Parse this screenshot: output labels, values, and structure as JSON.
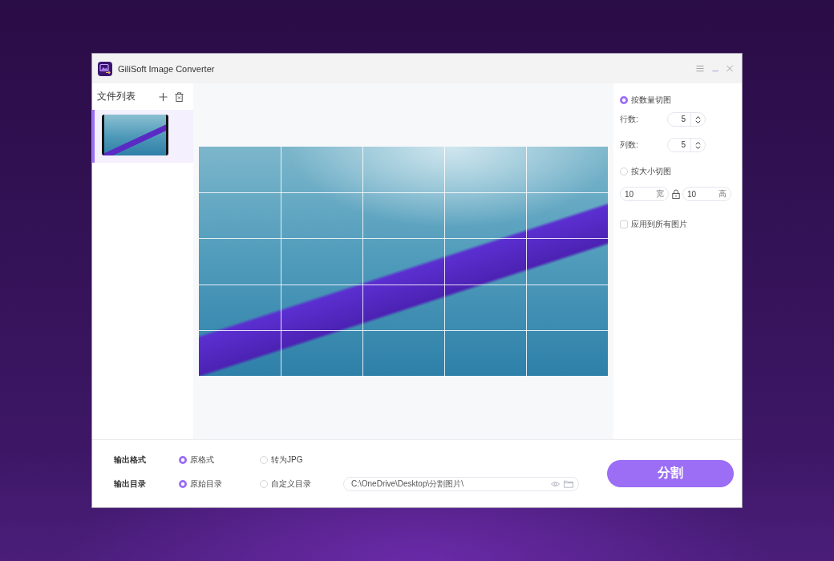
{
  "window": {
    "title": "GiliSoft Image Converter"
  },
  "file_list": {
    "title": "文件列表",
    "items": [
      {
        "selected": true
      }
    ]
  },
  "split_mode": [
    {
      "kind": "count",
      "label": "按数量切图",
      "selected": true,
      "fields": [
        {
          "label": "行数:",
          "value": "5"
        },
        {
          "label": "列数:",
          "value": "5"
        }
      ]
    },
    {
      "kind": "size",
      "label": "按大小切图",
      "selected": false,
      "fields": [
        {
          "value": "10",
          "unit": "宽"
        },
        {
          "value": "10",
          "unit": "高"
        }
      ]
    }
  ],
  "apply_all": {
    "label": "应用到所有图片",
    "checked": false
  },
  "output": [
    {
      "label": "输出格式",
      "options": [
        {
          "label": "原格式",
          "selected": true
        },
        {
          "label": "转为JPG",
          "selected": false
        }
      ]
    },
    {
      "label": "输出目录",
      "options": [
        {
          "label": "原始目录",
          "selected": true
        },
        {
          "label": "自定义目录",
          "selected": false
        }
      ],
      "path": "C:\\OneDrive\\Desktop\\分割图片\\"
    }
  ],
  "split_button": "分割"
}
